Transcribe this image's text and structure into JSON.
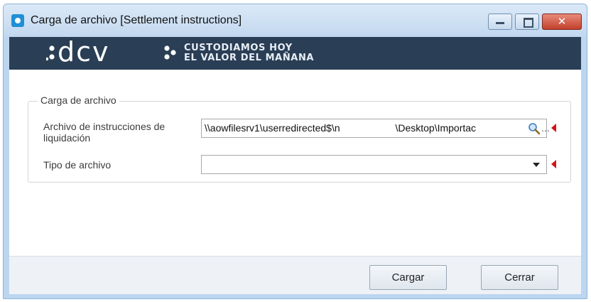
{
  "window": {
    "title": "Carga de archivo [Settlement instructions]",
    "close_glyph": "✕"
  },
  "banner": {
    "logo_text": "dcv",
    "tagline_line1": "CUSTODIAMOS HOY",
    "tagline_line2": "EL VALOR DEL MAÑANA"
  },
  "group": {
    "title": "Carga de archivo",
    "file_label": "Archivo de instrucciones de liquidación",
    "file_value": "\\\\aowfilesrv1\\userredirected$\\n                    \\Desktop\\Importac",
    "file_value_tail": "...",
    "type_label": "Tipo de archivo",
    "type_value": ""
  },
  "buttons": {
    "load": "Cargar",
    "close": "Cerrar"
  },
  "icons": {
    "search": "search-icon",
    "dropdown": "chevron-down-icon",
    "required": "required-marker-icon"
  },
  "colors": {
    "banner_bg": "#2a3e55",
    "required_marker": "#d4131b",
    "window_border": "#bcd6f0"
  }
}
